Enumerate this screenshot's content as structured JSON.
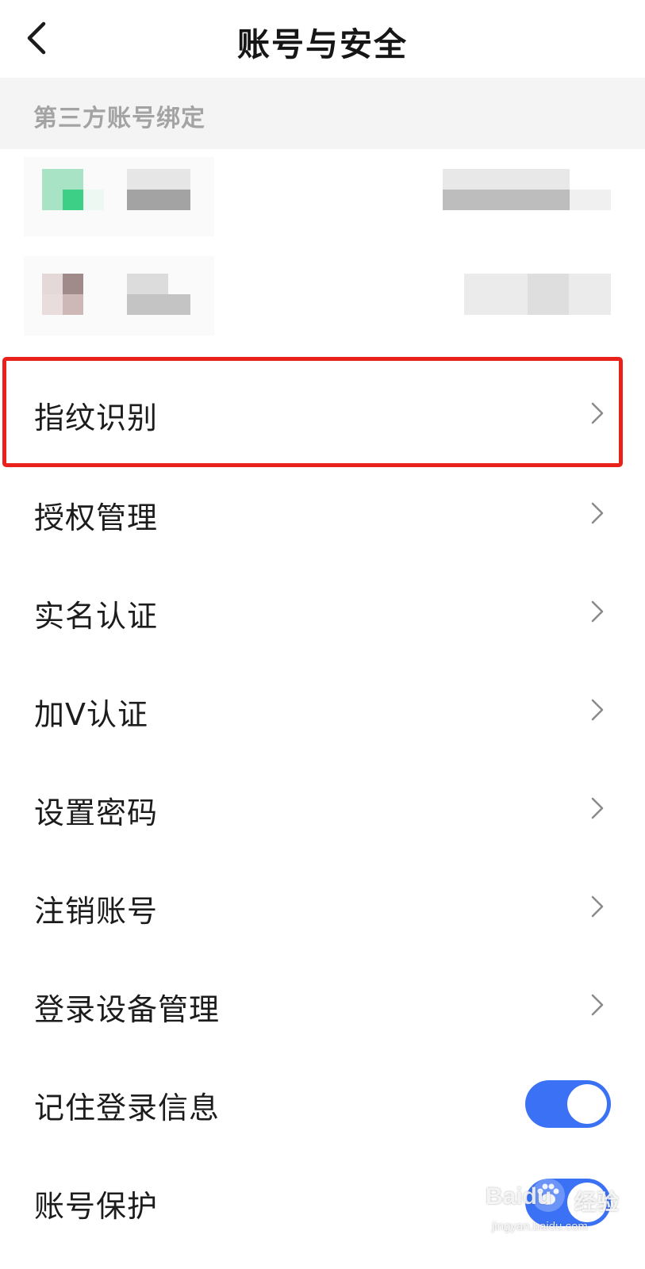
{
  "header": {
    "title": "账号与安全",
    "back_icon": "chevron-left-icon"
  },
  "section": {
    "title": "第三方账号绑定"
  },
  "menu": [
    {
      "id": "fingerprint",
      "label": "指纹识别",
      "type": "link"
    },
    {
      "id": "authorization",
      "label": "授权管理",
      "type": "link"
    },
    {
      "id": "realname",
      "label": "实名认证",
      "type": "link"
    },
    {
      "id": "verify-v",
      "label": "加V认证",
      "type": "link"
    },
    {
      "id": "password",
      "label": "设置密码",
      "type": "link"
    },
    {
      "id": "cancel-account",
      "label": "注销账号",
      "type": "link"
    },
    {
      "id": "devices",
      "label": "登录设备管理",
      "type": "link"
    },
    {
      "id": "remember-login",
      "label": "记住登录信息",
      "type": "toggle",
      "on": true
    },
    {
      "id": "account-protection",
      "label": "账号保护",
      "type": "toggle",
      "on": true
    }
  ],
  "colors": {
    "accent": "#3b72f5",
    "highlight": "#e8221a",
    "section_bg": "#f4f4f4"
  },
  "watermark": {
    "brand": "Baidu",
    "sub": "经验",
    "url": "jingyan.baidu.com"
  }
}
